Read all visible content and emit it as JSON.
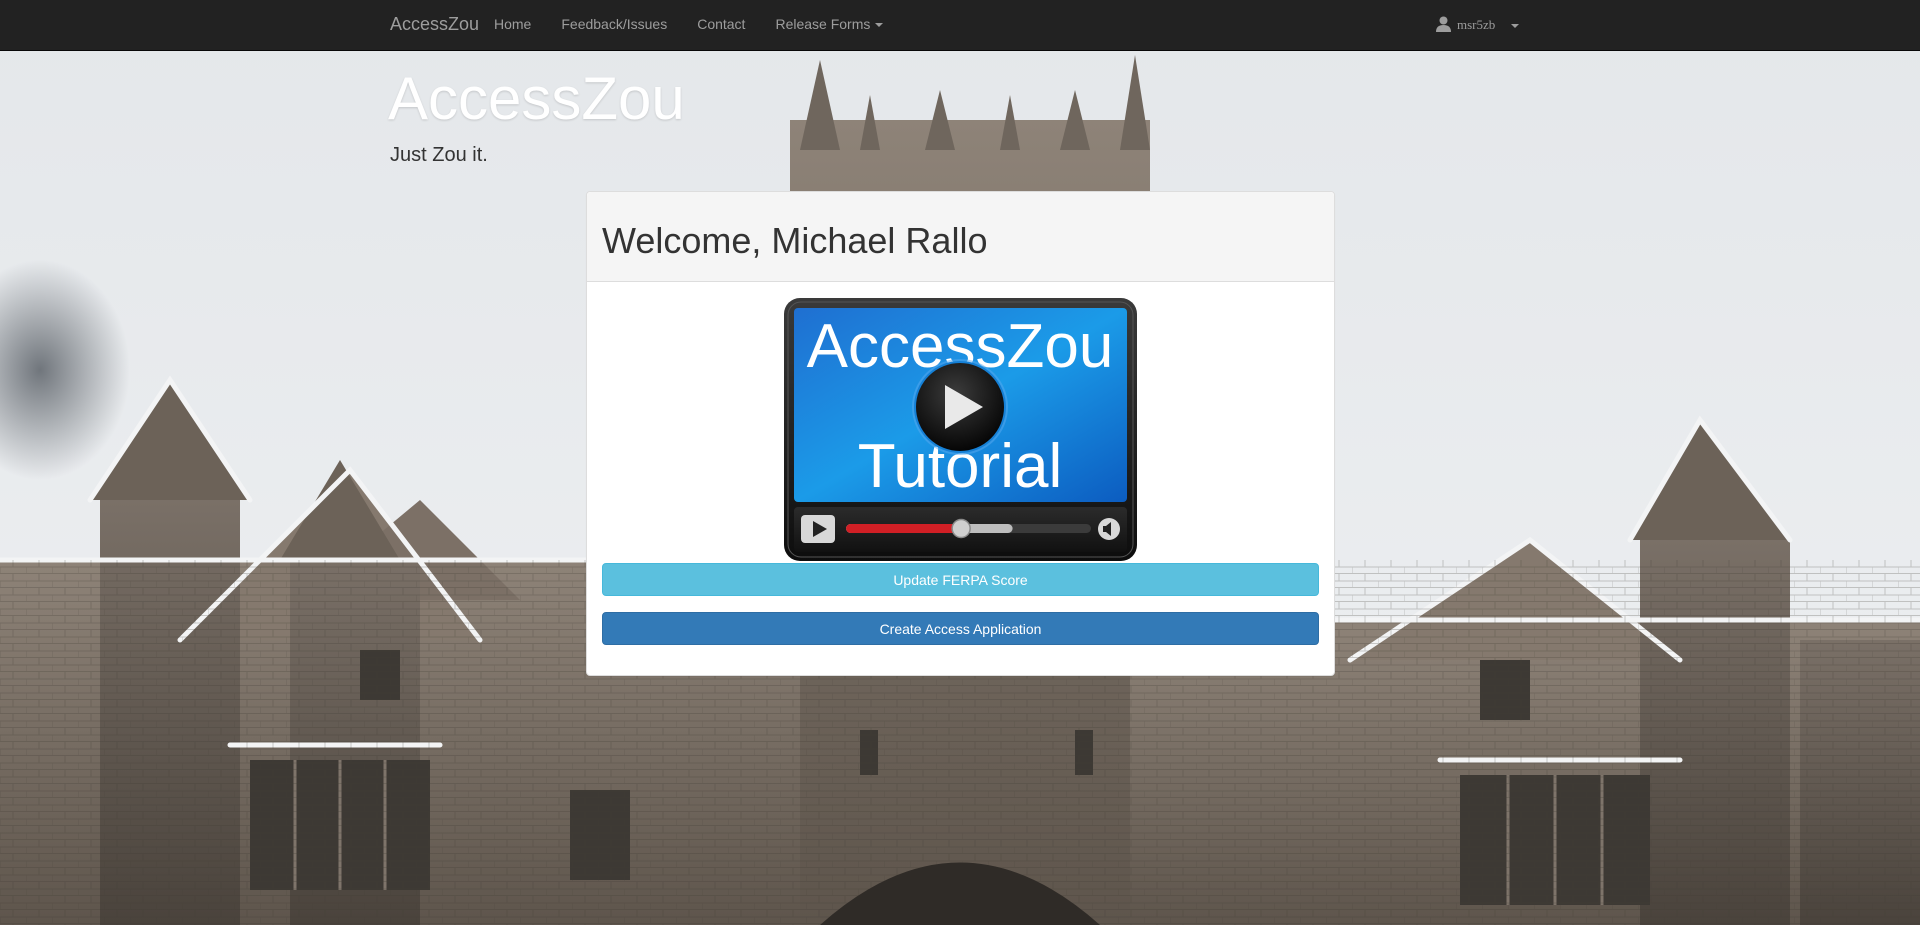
{
  "navbar": {
    "brand": "AccessZou",
    "items": [
      {
        "label": "Home"
      },
      {
        "label": "Feedback/Issues"
      },
      {
        "label": "Contact"
      },
      {
        "label": "Release Forms",
        "dropdown": true
      }
    ],
    "user": {
      "icon": "user-icon",
      "username": "msr5zb"
    }
  },
  "hero": {
    "title": "AccessZou",
    "subtitle": "Just Zou it."
  },
  "panel": {
    "heading": "Welcome, Michael Rallo",
    "video": {
      "line1": "AccessZou",
      "line2": "Tutorial",
      "icon": "play-icon",
      "progress": 0.47,
      "buffered": 0.68
    },
    "buttons": {
      "ferpa": "Update FERPA Score",
      "access": "Create Access Application"
    }
  },
  "colors": {
    "navbar": "#222222",
    "info": "#5bc0de",
    "primary": "#337ab7",
    "video_blue": "#1b8fe6"
  }
}
